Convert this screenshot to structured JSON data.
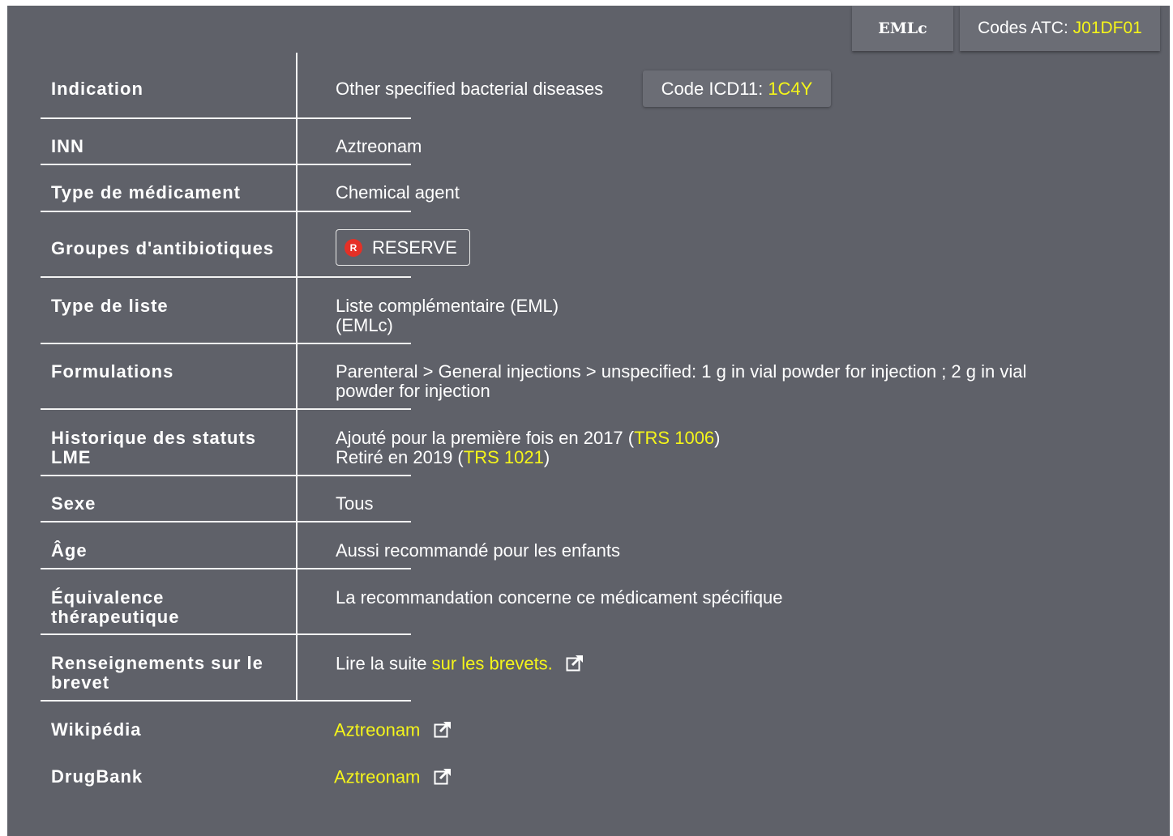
{
  "header": {
    "eml_tab": "EMLc",
    "atc_label": "Codes ATC: ",
    "atc_code": "J01DF01"
  },
  "icd": {
    "label": "Code ICD11: ",
    "code": "1C4Y"
  },
  "rows": {
    "indication": {
      "label": "Indication",
      "value": "Other specified bacterial diseases"
    },
    "inn": {
      "label": "INN",
      "value": "Aztreonam"
    },
    "type_medicament": {
      "label": "Type de médicament",
      "value": "Chemical agent"
    },
    "groupes": {
      "label": "Groupes d'antibiotiques",
      "badge_letter": "R",
      "badge_text": "RESERVE"
    },
    "type_liste": {
      "label": "Type de liste",
      "value_line1": "Liste complémentaire (EML)",
      "value_line2": "(EMLc)"
    },
    "formulations": {
      "label": "Formulations",
      "value_line1": "Parenteral > General injections > unspecified: 1 g in vial powder for injection ; 2 g in vial",
      "value_line2": "powder for injection"
    },
    "historique": {
      "label_line1": "Historique des statuts",
      "label_line2": "LME",
      "line1_prefix": "Ajouté pour la première fois en 2017 (",
      "line1_link": "TRS 1006",
      "line1_suffix": ")",
      "line2_prefix": "Retiré en 2019 (",
      "line2_link": "TRS 1021",
      "line2_suffix": ")"
    },
    "sexe": {
      "label": "Sexe",
      "value": "Tous"
    },
    "age": {
      "label": "Âge",
      "value": "Aussi recommandé pour les enfants"
    },
    "equivalence": {
      "label_line1": "Équivalence",
      "label_line2": "thérapeutique",
      "value": "La recommandation concerne ce médicament spécifique"
    },
    "brevet": {
      "label_line1": "Renseignements sur le",
      "label_line2": "brevet",
      "value_prefix": "Lire la suite ",
      "link": "sur les brevets."
    },
    "wikipedia": {
      "label": "Wikipédia",
      "link": "Aztreonam"
    },
    "drugbank": {
      "label": "DrugBank",
      "link": "Aztreonam"
    }
  },
  "colors": {
    "panel": "#5f6169",
    "accent_link": "#f5f51a",
    "reserve_red": "#e53026"
  },
  "icons": {
    "external": "external-link-icon"
  }
}
